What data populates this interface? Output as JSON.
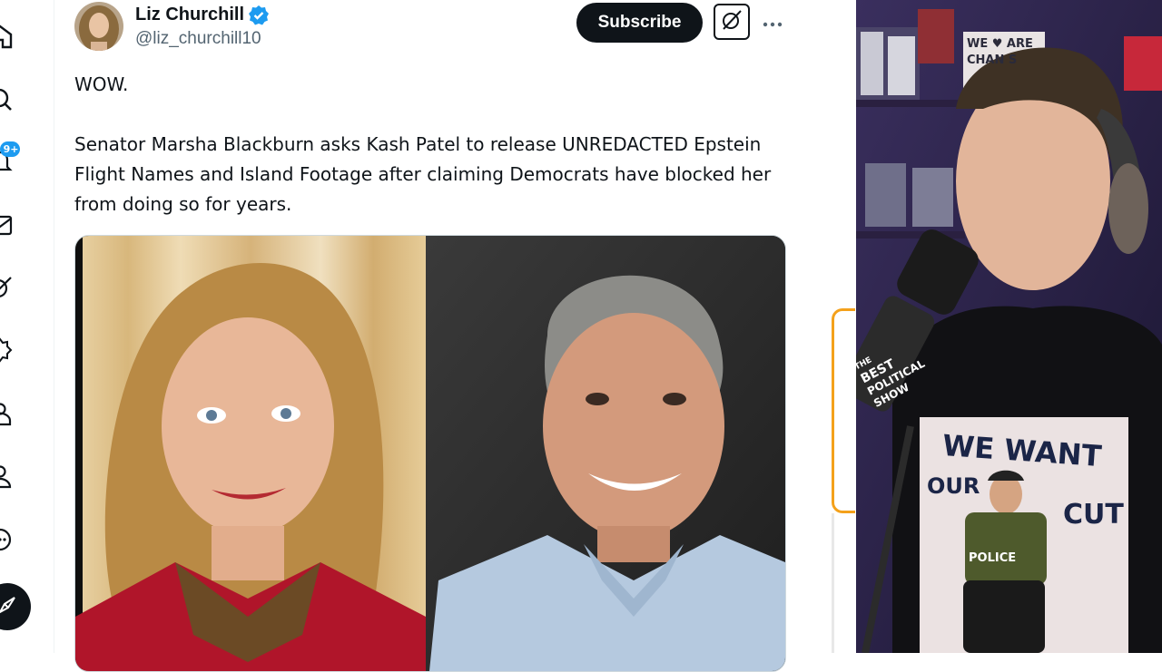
{
  "nav": {
    "badge": "9+",
    "icons": [
      "home-icon",
      "search-icon",
      "notifications-icon",
      "messages-icon",
      "grok-icon",
      "communities-icon",
      "premium-icon",
      "profile-icon",
      "more-icon",
      "post-icon"
    ]
  },
  "tweet": {
    "author_name": "Liz Churchill",
    "author_handle": "@liz_churchill10",
    "verified": true,
    "subscribe_label": "Subscribe",
    "more_label": "···",
    "paragraphs": [
      "WOW.",
      "Senator Marsha Blackburn asks Kash Patel to release UNREDACTED Epstein Flight Names and Island Footage after claiming Democrats have blocked her from doing so for years."
    ]
  },
  "webcam": {
    "mic_logo": [
      "THE",
      "BEST",
      "POLITICAL",
      "SHOW"
    ],
    "shirt_lines": [
      "WE WANT",
      "OUR",
      "CUT"
    ],
    "shirt_badge": "POLICE",
    "shelf_sign": "WE ♥ ARE CHAN S"
  },
  "colors": {
    "accent_blue": "#1d9bf0",
    "text_primary": "#0f1419",
    "text_secondary": "#536471",
    "frame_orange": "#f4a11b"
  }
}
